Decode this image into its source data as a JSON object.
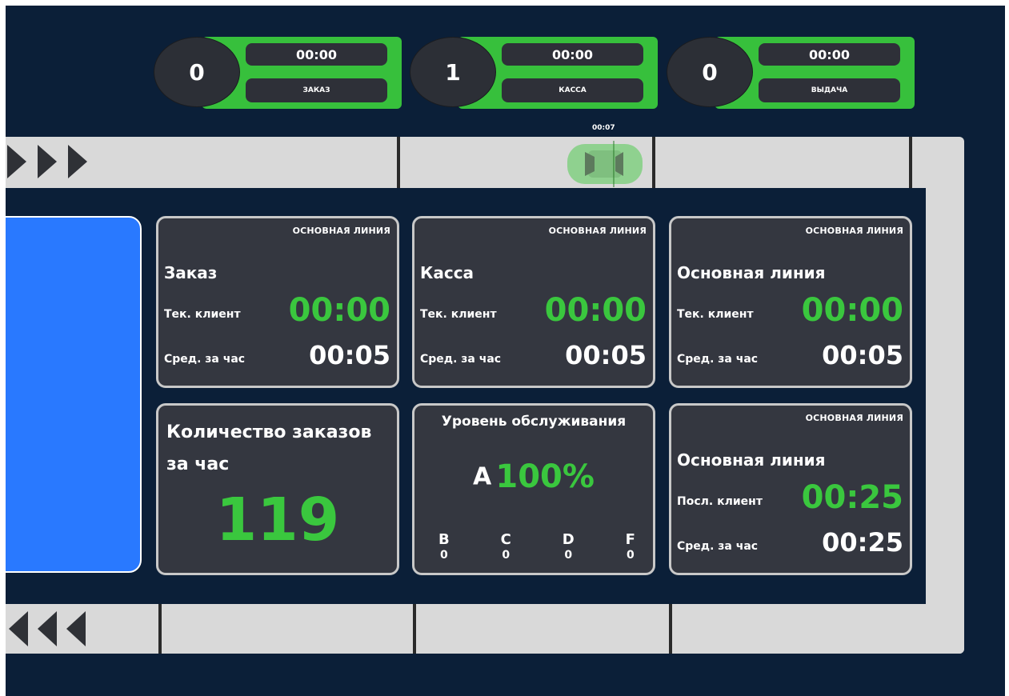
{
  "counters": [
    {
      "count": "0",
      "time": "00:00",
      "label": "ЗАКАЗ"
    },
    {
      "count": "1",
      "time": "00:00",
      "label": "КАССА"
    },
    {
      "count": "0",
      "time": "00:00",
      "label": "ВЫДАЧА"
    }
  ],
  "car": {
    "time": "00:07",
    "color": "#8fd18f"
  },
  "cards": {
    "order": {
      "tag": "ОСНОВНАЯ ЛИНИЯ",
      "title": "Заказ",
      "current_label": "Тек. клиент",
      "current_value": "00:00",
      "avg_label": "Сред. за час",
      "avg_value": "00:05"
    },
    "cash": {
      "tag": "ОСНОВНАЯ ЛИНИЯ",
      "title": "Касса",
      "current_label": "Тек. клиент",
      "current_value": "00:00",
      "avg_label": "Сред. за час",
      "avg_value": "00:05"
    },
    "main": {
      "tag": "ОСНОВНАЯ ЛИНИЯ",
      "title": "Основная линия",
      "current_label": "Тек. клиент",
      "current_value": "00:00",
      "avg_label": "Сред. за час",
      "avg_value": "00:05"
    },
    "orders_per_hour": {
      "title": "Количество заказов за час",
      "value": "119"
    },
    "service_level": {
      "title": "Уровень обслуживания",
      "grade": "A",
      "percent": "100%",
      "grades": [
        {
          "grade": "B",
          "count": "0"
        },
        {
          "grade": "C",
          "count": "0"
        },
        {
          "grade": "D",
          "count": "0"
        },
        {
          "grade": "F",
          "count": "0"
        }
      ]
    },
    "last_client": {
      "tag": "ОСНОВНАЯ ЛИНИЯ",
      "title": "Основная линия",
      "last_label": "Посл. клиент",
      "last_value": "00:25",
      "avg_label": "Сред. за час",
      "avg_value": "00:25"
    }
  },
  "colors": {
    "background": "#0b1f38",
    "accent_green": "#37c03c",
    "card": "#343740",
    "lane_blue": "#2979ff",
    "road": "#d9d9d9"
  }
}
